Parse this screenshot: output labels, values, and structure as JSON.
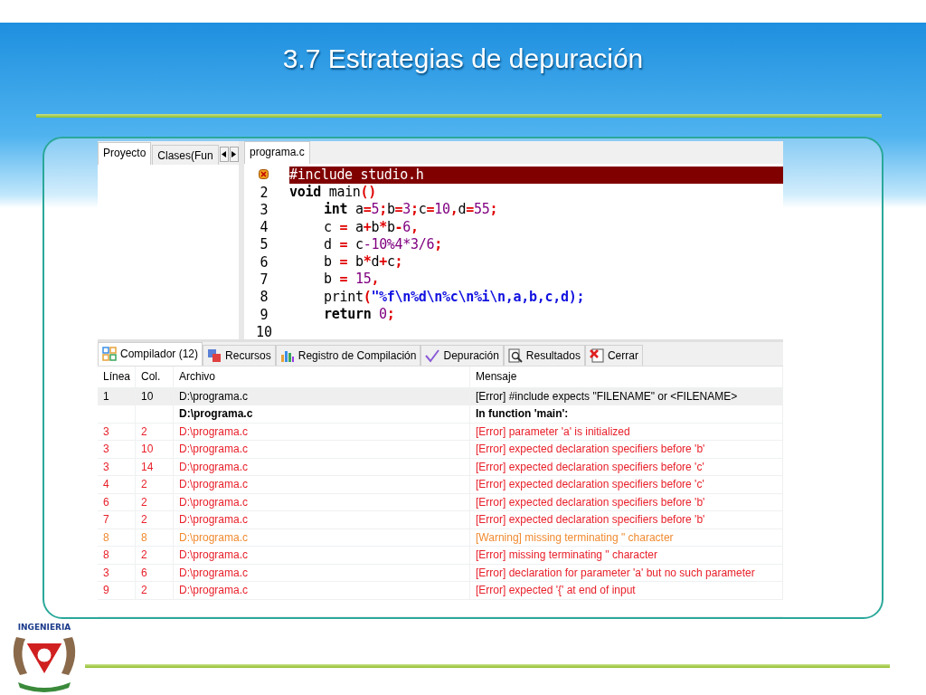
{
  "title": "3.7  Estrategias de depuración",
  "logo": {
    "text": "INGENIERIA"
  },
  "ide": {
    "left_tabs": [
      {
        "label": "Proyecto",
        "selected": true
      },
      {
        "label": "Clases(Fun",
        "selected": false
      }
    ],
    "editor_tabs": [
      {
        "label": "programa.c",
        "selected": true
      }
    ],
    "code": [
      {
        "error": true,
        "indent": false,
        "tokens": [
          {
            "kind": "plain",
            "text": "#include studio.h"
          }
        ]
      },
      {
        "number": "2",
        "error": false,
        "indent": false,
        "tokens": [
          {
            "kind": "keyword",
            "text": "void"
          },
          {
            "kind": "plain",
            "text": " main"
          },
          {
            "kind": "symbol",
            "text": "()"
          }
        ]
      },
      {
        "number": "3",
        "error": false,
        "indent": true,
        "tokens": [
          {
            "kind": "keyword",
            "text": "int"
          },
          {
            "kind": "plain",
            "text": " a"
          },
          {
            "kind": "symbol",
            "text": "="
          },
          {
            "kind": "number",
            "text": "5"
          },
          {
            "kind": "symbol",
            "text": ";"
          },
          {
            "kind": "plain",
            "text": "b"
          },
          {
            "kind": "symbol",
            "text": "="
          },
          {
            "kind": "number",
            "text": "3"
          },
          {
            "kind": "symbol",
            "text": ";"
          },
          {
            "kind": "plain",
            "text": "c"
          },
          {
            "kind": "symbol",
            "text": "="
          },
          {
            "kind": "number",
            "text": "10"
          },
          {
            "kind": "symbol",
            "text": ","
          },
          {
            "kind": "plain",
            "text": "d"
          },
          {
            "kind": "symbol",
            "text": "="
          },
          {
            "kind": "number",
            "text": "55"
          },
          {
            "kind": "symbol",
            "text": ";"
          }
        ]
      },
      {
        "number": "4",
        "error": false,
        "indent": true,
        "tokens": [
          {
            "kind": "plain",
            "text": "c "
          },
          {
            "kind": "symbol",
            "text": "="
          },
          {
            "kind": "plain",
            "text": " a"
          },
          {
            "kind": "symbol",
            "text": "+"
          },
          {
            "kind": "plain",
            "text": "b"
          },
          {
            "kind": "symbol",
            "text": "*"
          },
          {
            "kind": "plain",
            "text": "b"
          },
          {
            "kind": "symbol",
            "text": "-"
          },
          {
            "kind": "number",
            "text": "6"
          },
          {
            "kind": "symbol",
            "text": ","
          }
        ]
      },
      {
        "number": "5",
        "error": false,
        "indent": true,
        "tokens": [
          {
            "kind": "plain",
            "text": "d "
          },
          {
            "kind": "symbol",
            "text": "="
          },
          {
            "kind": "plain",
            "text": " c"
          },
          {
            "kind": "number",
            "text": "-10%4*3/6"
          },
          {
            "kind": "symbol",
            "text": ";"
          }
        ]
      },
      {
        "number": "6",
        "error": false,
        "indent": true,
        "tokens": [
          {
            "kind": "plain",
            "text": "b "
          },
          {
            "kind": "symbol",
            "text": "="
          },
          {
            "kind": "plain",
            "text": " b"
          },
          {
            "kind": "symbol",
            "text": "*"
          },
          {
            "kind": "plain",
            "text": "d"
          },
          {
            "kind": "symbol",
            "text": "+"
          },
          {
            "kind": "plain",
            "text": "c"
          },
          {
            "kind": "symbol",
            "text": ";"
          }
        ]
      },
      {
        "number": "7",
        "error": false,
        "indent": true,
        "tokens": [
          {
            "kind": "plain",
            "text": "b "
          },
          {
            "kind": "symbol",
            "text": "="
          },
          {
            "kind": "number",
            "text": " 15"
          },
          {
            "kind": "symbol",
            "text": ","
          }
        ]
      },
      {
        "number": "8",
        "error": false,
        "indent": true,
        "tokens": [
          {
            "kind": "plain",
            "text": "print"
          },
          {
            "kind": "symbol",
            "text": "("
          },
          {
            "kind": "string",
            "text": "\"%f\\n%d\\n%c\\n%i\\n,a,b,c,d);"
          }
        ]
      },
      {
        "number": "9",
        "error": false,
        "indent": true,
        "tokens": [
          {
            "kind": "keyword",
            "text": "return"
          },
          {
            "kind": "number",
            "text": " 0"
          },
          {
            "kind": "symbol",
            "text": ";"
          }
        ]
      },
      {
        "number": "10"
      }
    ],
    "bottom_tabs": [
      {
        "label": "Compilador (12)",
        "selected": true
      },
      {
        "label": "Recursos",
        "selected": false
      },
      {
        "label": "Registro de Compilación",
        "selected": false
      },
      {
        "label": "Depuración",
        "selected": false
      },
      {
        "label": "Resultados",
        "selected": false
      },
      {
        "label": "Cerrar",
        "selected": false
      }
    ],
    "table": {
      "columns": [
        "Línea",
        "Col.",
        "Archivo",
        "Mensaje"
      ],
      "rows": [
        {
          "kind": "normal",
          "selected": true,
          "cells": [
            "1",
            "10",
            "D:\\programa.c",
            "[Error] #include expects \"FILENAME\" or <FILENAME>"
          ]
        },
        {
          "kind": "bold",
          "selected": false,
          "cells": [
            "",
            "",
            "D:\\programa.c",
            "In function 'main':"
          ]
        },
        {
          "kind": "error",
          "selected": false,
          "cells": [
            "3",
            "2",
            "D:\\programa.c",
            "[Error] parameter 'a' is initialized"
          ]
        },
        {
          "kind": "error",
          "selected": false,
          "cells": [
            "3",
            "10",
            "D:\\programa.c",
            "[Error] expected declaration specifiers before 'b'"
          ]
        },
        {
          "kind": "error",
          "selected": false,
          "cells": [
            "3",
            "14",
            "D:\\programa.c",
            "[Error] expected declaration specifiers before 'c'"
          ]
        },
        {
          "kind": "error",
          "selected": false,
          "cells": [
            "4",
            "2",
            "D:\\programa.c",
            "[Error] expected declaration specifiers before 'c'"
          ]
        },
        {
          "kind": "error",
          "selected": false,
          "cells": [
            "6",
            "2",
            "D:\\programa.c",
            "[Error] expected declaration specifiers before 'b'"
          ]
        },
        {
          "kind": "error",
          "selected": false,
          "cells": [
            "7",
            "2",
            "D:\\programa.c",
            "[Error] expected declaration specifiers before 'b'"
          ]
        },
        {
          "kind": "warning",
          "selected": false,
          "cells": [
            "8",
            "8",
            "D:\\programa.c",
            "[Warning] missing terminating \" character"
          ]
        },
        {
          "kind": "error",
          "selected": false,
          "cells": [
            "8",
            "2",
            "D:\\programa.c",
            "[Error] missing terminating \" character"
          ]
        },
        {
          "kind": "error",
          "selected": false,
          "cells": [
            "3",
            "6",
            "D:\\programa.c",
            "[Error] declaration for parameter 'a' but no such parameter"
          ]
        },
        {
          "kind": "error",
          "selected": false,
          "cells": [
            "9",
            "2",
            "D:\\programa.c",
            "[Error] expected '{' at end of input"
          ]
        }
      ]
    }
  }
}
